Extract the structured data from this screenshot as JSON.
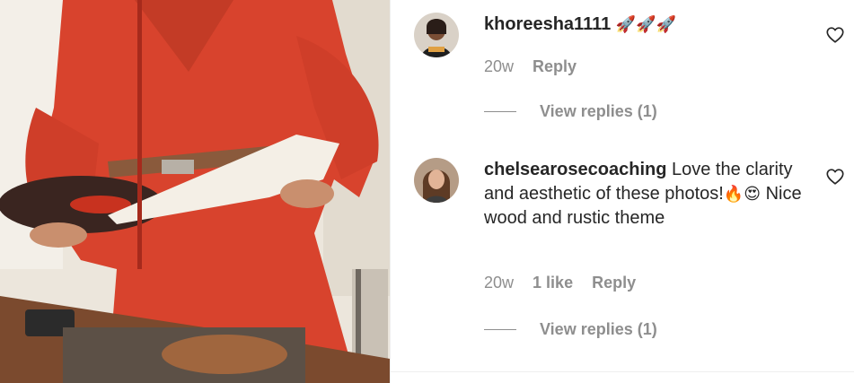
{
  "comments": [
    {
      "username": "khoreesha1111",
      "text": "",
      "emoji": "🚀🚀🚀",
      "age": "20w",
      "likes": "",
      "reply_label": "Reply",
      "view_replies": "View replies (1)",
      "like_icon": "heart-outline-icon"
    },
    {
      "username": "chelsearosecoaching",
      "text_part1": "Love the clarity and aesthetic of these photos!",
      "emoji": "🔥😍",
      "text_part2": "Nice wood and rustic theme",
      "age": "20w",
      "likes": "1 like",
      "reply_label": "Reply",
      "view_replies": "View replies (1)",
      "like_icon": "heart-outline-icon"
    }
  ],
  "colors": {
    "text_primary": "#262626",
    "text_secondary": "#8e8e8e",
    "dress_red": "#d8432d",
    "background": "#ffffff"
  }
}
